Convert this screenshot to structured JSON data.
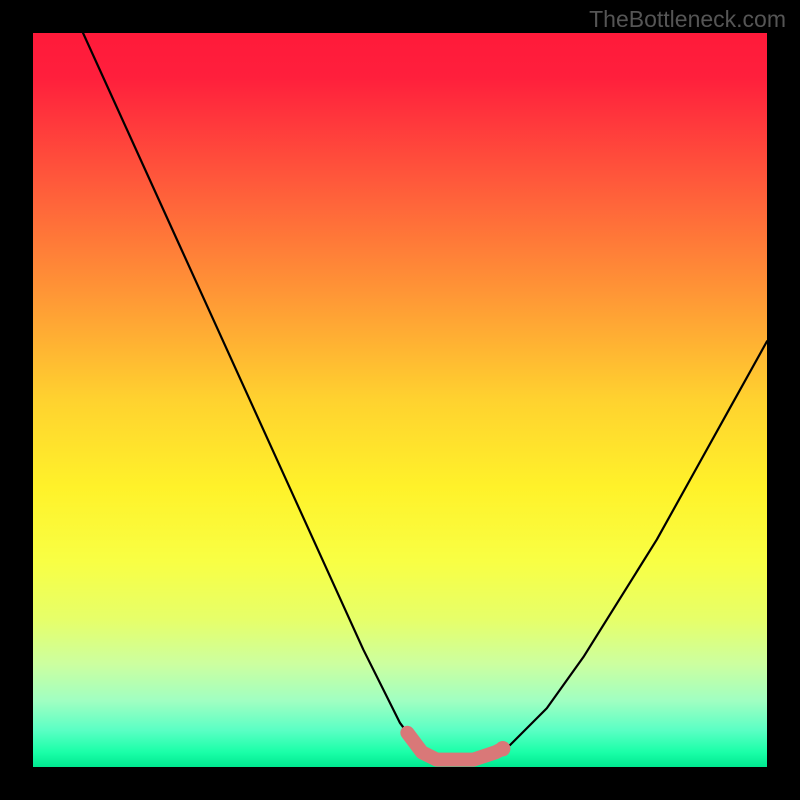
{
  "watermark": "TheBottleneck.com",
  "chart_data": {
    "type": "line",
    "title": "",
    "xlabel": "",
    "ylabel": "",
    "xlim": [
      0,
      100
    ],
    "ylim": [
      0,
      100
    ],
    "grid": false,
    "legend": false,
    "series": [
      {
        "name": "bottleneck-curve",
        "x": [
          0,
          5,
          10,
          15,
          20,
          25,
          30,
          35,
          40,
          45,
          50,
          53,
          55,
          58,
          60,
          63,
          65,
          70,
          75,
          80,
          85,
          90,
          95,
          100
        ],
        "values": [
          115,
          104,
          93,
          82,
          71,
          60,
          49,
          38,
          27,
          16,
          6,
          2,
          1,
          1,
          1,
          2,
          3,
          8,
          15,
          23,
          31,
          40,
          49,
          58
        ]
      }
    ],
    "highlight_segment": {
      "name": "optimal-range",
      "x_start": 51,
      "x_end": 64,
      "color": "#d97878",
      "thickness": 14
    },
    "background_gradient": {
      "stops": [
        {
          "pos": 0.0,
          "color": "#ff1a3a"
        },
        {
          "pos": 0.06,
          "color": "#ff1f3c"
        },
        {
          "pos": 0.2,
          "color": "#ff583b"
        },
        {
          "pos": 0.35,
          "color": "#ff9436"
        },
        {
          "pos": 0.5,
          "color": "#ffd22f"
        },
        {
          "pos": 0.62,
          "color": "#fff22a"
        },
        {
          "pos": 0.72,
          "color": "#f8ff44"
        },
        {
          "pos": 0.8,
          "color": "#e6ff6a"
        },
        {
          "pos": 0.86,
          "color": "#ccffa0"
        },
        {
          "pos": 0.91,
          "color": "#a0ffc2"
        },
        {
          "pos": 0.95,
          "color": "#5affc4"
        },
        {
          "pos": 0.98,
          "color": "#1affa8"
        },
        {
          "pos": 1.0,
          "color": "#00e890"
        }
      ]
    }
  }
}
